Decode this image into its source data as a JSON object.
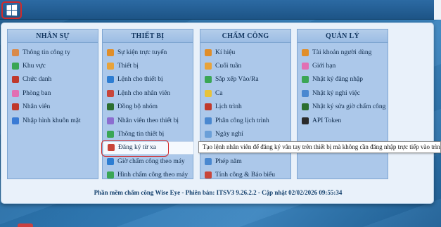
{
  "start_button": {
    "icon": "windows-logo-icon"
  },
  "columns": [
    {
      "title": "NHÂN SỰ",
      "items": [
        {
          "label": "Thông tin công ty",
          "icon": "company-icon",
          "color": "#d98a4a"
        },
        {
          "label": "Khu vực",
          "icon": "location-icon",
          "color": "#3aa655"
        },
        {
          "label": "Chức danh",
          "icon": "position-icon",
          "color": "#c0392b"
        },
        {
          "label": "Phòng ban",
          "icon": "department-icon",
          "color": "#e26fb3"
        },
        {
          "label": "Nhân viên",
          "icon": "employee-icon",
          "color": "#c0392b"
        },
        {
          "label": "Nhập hình khuôn mặt",
          "icon": "face-icon",
          "color": "#3a7bd5"
        }
      ]
    },
    {
      "title": "THIẾT BỊ",
      "items": [
        {
          "label": "Sự kiện trực tuyến",
          "icon": "online-event-icon",
          "color": "#e08e2a"
        },
        {
          "label": "Thiết bị",
          "icon": "device-icon",
          "color": "#e8a33a"
        },
        {
          "label": "Lệnh cho thiết bị",
          "icon": "device-command-icon",
          "color": "#2d7dd2"
        },
        {
          "label": "Lệnh cho nhân viên",
          "icon": "employee-command-icon",
          "color": "#c8453a"
        },
        {
          "label": "Đồng bộ nhóm",
          "icon": "sync-icon",
          "color": "#2b6e2f"
        },
        {
          "label": "Nhân viên theo thiết bị",
          "icon": "employee-device-icon",
          "color": "#8c6dd0"
        },
        {
          "label": "Thông tin thiết bị",
          "icon": "device-info-icon",
          "color": "#3aa655"
        },
        {
          "label": "Đăng ký từ xa",
          "icon": "remote-register-icon",
          "color": "#c8453a",
          "highlight": true
        },
        {
          "label": "Giờ chấm công theo máy",
          "icon": "clock-icon",
          "color": "#2d7dd2"
        },
        {
          "label": "Hình chấm công theo máy",
          "icon": "image-icon",
          "color": "#3aa655"
        }
      ]
    },
    {
      "title": "CHẤM CÔNG",
      "items": [
        {
          "label": "Kí hiệu",
          "icon": "symbol-icon",
          "color": "#e08e2a"
        },
        {
          "label": "Cuối tuần",
          "icon": "weekend-icon",
          "color": "#e8a33a"
        },
        {
          "label": "Sắp xếp Vào/Ra",
          "icon": "sort-inout-icon",
          "color": "#3aa655"
        },
        {
          "label": "Ca",
          "icon": "shift-icon",
          "color": "#e8c33a"
        },
        {
          "label": "Lịch trình",
          "icon": "schedule-icon",
          "color": "#c0392b"
        },
        {
          "label": "Phân công lịch trình",
          "icon": "assign-schedule-icon",
          "color": "#4a88d0"
        },
        {
          "label": "Ngày nghỉ",
          "icon": "holiday-icon",
          "color": "#6a9fd8"
        },
        {
          "label": "",
          "icon": "blank-icon",
          "color": "#acc8ea"
        },
        {
          "label": "Phép năm",
          "icon": "annual-leave-icon",
          "color": "#4a88d0"
        },
        {
          "label": "Tính công & Báo biểu",
          "icon": "report-icon",
          "color": "#c8453a"
        }
      ]
    },
    {
      "title": "QUẢN LÝ",
      "items": [
        {
          "label": "Tài khoản người dùng",
          "icon": "user-account-icon",
          "color": "#e08e2a"
        },
        {
          "label": "Giới hạn",
          "icon": "limit-icon",
          "color": "#e26fb3"
        },
        {
          "label": "Nhật ký đăng nhập",
          "icon": "login-log-icon",
          "color": "#3aa655"
        },
        {
          "label": "Nhật ký nghỉ việc",
          "icon": "resign-log-icon",
          "color": "#4a88d0"
        },
        {
          "label": "Nhật ký sửa giờ chấm công",
          "icon": "edit-log-icon",
          "color": "#2b6e2f"
        },
        {
          "label": "API Token",
          "icon": "api-token-icon",
          "color": "#2a2a2a"
        }
      ]
    }
  ],
  "footer": "Phần mềm chấm công Wise Eye - Phiên bản: ITSV3 9.26.2.2 - Cập nhật 02/02/2026 09:55:34",
  "tooltip": "Tạo lệnh nhân viên để đăng ký vân tay trên thiết bị mà không cần đăng nhập trực tiếp vào trình"
}
